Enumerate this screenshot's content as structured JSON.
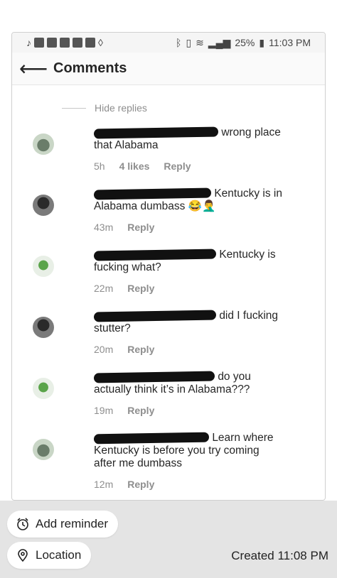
{
  "status_bar": {
    "battery": "25%",
    "time": "11:03 PM"
  },
  "header": {
    "title": "Comments"
  },
  "hide_replies": "Hide replies",
  "comments": [
    {
      "text_line1": "wrong place",
      "text_line2": "that Alabama",
      "text_line3": "",
      "time": "5h",
      "likes": "4 likes",
      "reply": "Reply"
    },
    {
      "text_line1": "Kentucky is in",
      "text_line2": "Alabama dumbass 😂🤦‍♂️",
      "text_line3": "",
      "time": "43m",
      "likes": "",
      "reply": "Reply"
    },
    {
      "text_line1": "Kentucky is",
      "text_line2": "fucking what?",
      "text_line3": "",
      "time": "22m",
      "likes": "",
      "reply": "Reply"
    },
    {
      "text_line1": "did I fucking",
      "text_line2": "stutter?",
      "text_line3": "",
      "time": "20m",
      "likes": "",
      "reply": "Reply"
    },
    {
      "text_line1": "do you",
      "text_line2": "actually think it’s in Alabama???",
      "text_line3": "",
      "time": "19m",
      "likes": "",
      "reply": "Reply"
    },
    {
      "text_line1": "Learn where",
      "text_line2": "Kentucky is before you try coming",
      "text_line3": "after me dumbass",
      "time": "12m",
      "likes": "",
      "reply": "Reply"
    }
  ],
  "bottom_bar": {
    "add_reminder": "Add reminder",
    "location": "Location",
    "created": "Created 11:08 PM"
  },
  "colors": {
    "muted": "#8e8e8e",
    "text": "#262626",
    "bottom_bg": "#e4e4e4"
  },
  "icons": [
    "back-arrow-icon",
    "heart-icon",
    "alarm-clock-icon",
    "location-pin-icon"
  ]
}
